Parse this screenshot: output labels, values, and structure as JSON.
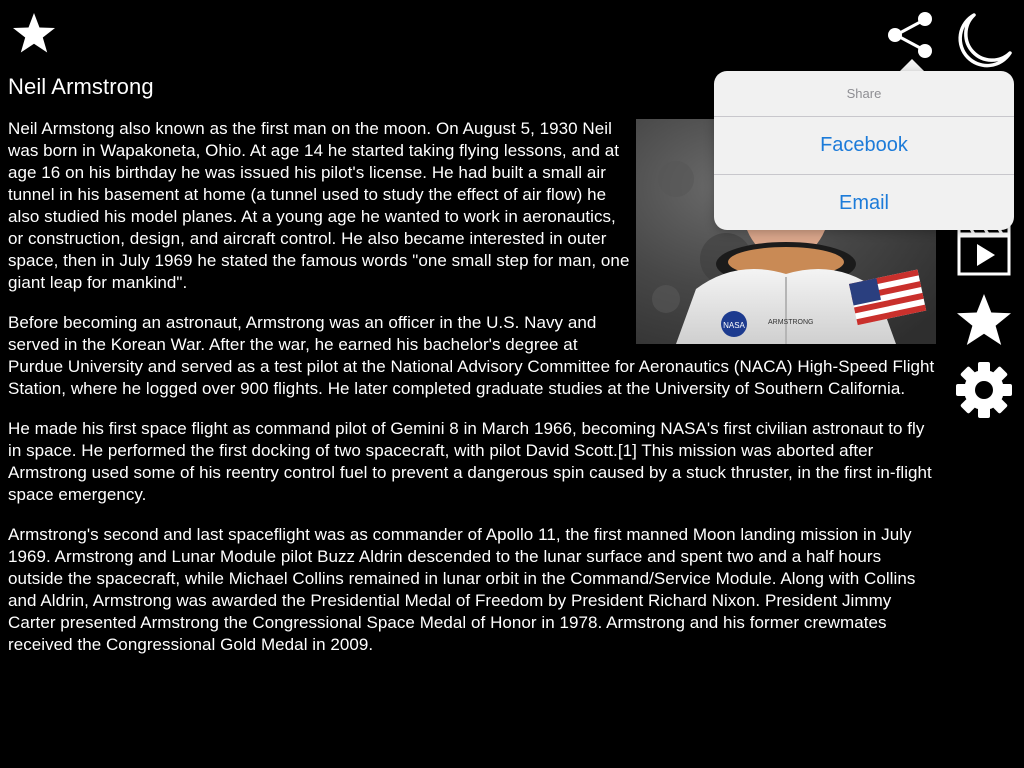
{
  "toolbar": {
    "top_left": {
      "icon": "star-icon"
    },
    "right": [
      {
        "icon": "share-icon"
      },
      {
        "icon": "moon-icon"
      },
      {
        "icon": "document-icon"
      },
      {
        "icon": "gallery-icon"
      },
      {
        "icon": "video-icon"
      },
      {
        "icon": "star-icon"
      },
      {
        "icon": "gear-icon"
      }
    ]
  },
  "article": {
    "title": "Neil Armstrong",
    "paragraphs": [
      "Neil Armstong also known as the first man on the moon. On August 5, 1930 Neil was born in Wapakoneta, Ohio. At age 14 he started taking flying lessons, and at age 16 on his birthday he was issued his pilot's license. He had built a small air tunnel in his basement at home (a tunnel used to study the effect of air flow) he also studied his model planes. At a young age he wanted to work in aeronautics, or construction, design, and aircraft control. He also became interested in outer space, then in July 1969 he stated the famous words \"one small step for man, one giant leap for mankind\".",
      "Before becoming an astronaut, Armstrong was an officer in the U.S. Navy and served in the Korean War. After the war, he earned his bachelor's degree at Purdue University and served as a test pilot at the National Advisory Committee for Aeronautics (NACA) High-Speed Flight Station, where he logged over 900 flights. He later completed graduate studies at the University of Southern California.",
      "He made his first space flight as command pilot of Gemini 8 in March 1966, becoming NASA's first civilian astronaut to fly in space. He performed the first docking of two spacecraft, with pilot David Scott.[1] This mission was aborted after Armstrong used some of his reentry control fuel to prevent a dangerous spin caused by a stuck thruster, in the first in-flight space emergency.",
      "Armstrong's second and last spaceflight was as commander of Apollo 11, the first manned Moon landing mission in July 1969. Armstrong and Lunar Module pilot Buzz Aldrin descended to the lunar surface and spent two and a half hours outside the spacecraft, while Michael Collins remained in lunar orbit in the Command/Service Module. Along with Collins and Aldrin, Armstrong was awarded the Presidential Medal of Freedom by President Richard Nixon. President Jimmy Carter presented Armstrong the Congressional Space Medal of Honor in 1978. Armstrong and his former crewmates received the Congressional Gold Medal in 2009."
    ],
    "photo": {
      "name_tag": "ARMSTRONG",
      "patch_text": "NASA"
    }
  },
  "share_popover": {
    "header": "Share",
    "options": [
      "Facebook",
      "Email"
    ]
  },
  "colors": {
    "background": "#000000",
    "text": "#ffffff",
    "popover_bg": "#f1f1f1",
    "popover_link": "#1c7bd9",
    "popover_header": "#8e8e93"
  }
}
